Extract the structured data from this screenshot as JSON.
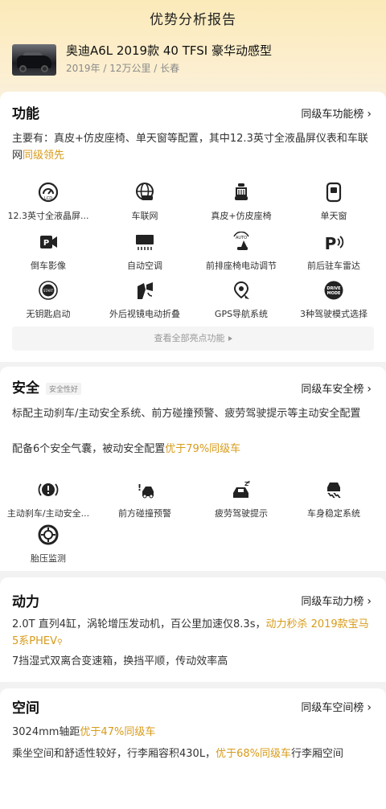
{
  "page_title": "优势分析报告",
  "car": {
    "name": "奥迪A6L 2019款 40 TFSI 豪华动感型",
    "meta": "2019年 / 12万公里 / 长春"
  },
  "function": {
    "title": "功能",
    "rank_label": "同级车功能榜",
    "desc_text": "主要有：真皮+仿皮座椅、单天窗等配置，其中12.3英寸全液晶屏仪表和车联网",
    "desc_highlight": "同级领先",
    "features": [
      {
        "icon": "lcd-gauge-icon",
        "label": "12.3英寸全液晶屏..."
      },
      {
        "icon": "connected-car-icon",
        "label": "车联网"
      },
      {
        "icon": "leather-seat-icon",
        "label": "真皮+仿皮座椅"
      },
      {
        "icon": "sunroof-icon",
        "label": "单天窗"
      },
      {
        "icon": "rear-camera-icon",
        "label": "倒车影像"
      },
      {
        "icon": "auto-ac-icon",
        "label": "自动空调"
      },
      {
        "icon": "power-seat-icon",
        "label": "前排座椅电动调节"
      },
      {
        "icon": "parking-radar-icon",
        "label": "前后驻车雷达"
      },
      {
        "icon": "keyless-start-icon",
        "label": "无钥匙启动"
      },
      {
        "icon": "power-fold-mirror-icon",
        "label": "外后视镜电动折叠"
      },
      {
        "icon": "gps-navigation-icon",
        "label": "GPS导航系统"
      },
      {
        "icon": "drive-mode-icon",
        "label": "3种驾驶模式选择"
      }
    ],
    "view_all_label": "查看全部亮点功能"
  },
  "safety": {
    "title": "安全",
    "badge": "安全性好",
    "rank_label": "同级车安全榜",
    "desc1": "标配主动刹车/主动安全系统、前方碰撞预警、疲劳驾驶提示等主动安全配置",
    "desc2_text": "配备6个安全气囊，被动安全配置",
    "desc2_highlight": "优于79%同级车",
    "features": [
      {
        "icon": "auto-brake-icon",
        "label": "主动刹车/主动安全..."
      },
      {
        "icon": "collision-warning-icon",
        "label": "前方碰撞预警"
      },
      {
        "icon": "fatigue-alert-icon",
        "label": "疲劳驾驶提示"
      },
      {
        "icon": "stability-control-icon",
        "label": "车身稳定系统"
      },
      {
        "icon": "tire-pressure-icon",
        "label": "胎压监测"
      }
    ]
  },
  "power": {
    "title": "动力",
    "rank_label": "同级车动力榜",
    "desc1_text": "2.0T 直列4缸，涡轮增压发动机，百公里加速仅8.3s，",
    "desc1_highlight": "动力秒杀 2019款宝马5系PHEV",
    "desc2": "7挡湿式双离合变速箱，换挡平顺，传动效率高"
  },
  "space": {
    "title": "空间",
    "rank_label": "同级车空间榜",
    "desc1_text": "3024mm轴距",
    "desc1_highlight": "优于47%同级车",
    "desc2_text": "乘坐空间和舒适性较好，行李厢容积430L，",
    "desc2_highlight": "优于68%同级车",
    "desc2_tail": "行李厢空间"
  },
  "colors": {
    "accent": "#d79b1a",
    "header_gradient_top": "#fbeab9",
    "page_bg": "#f2f2f2"
  }
}
